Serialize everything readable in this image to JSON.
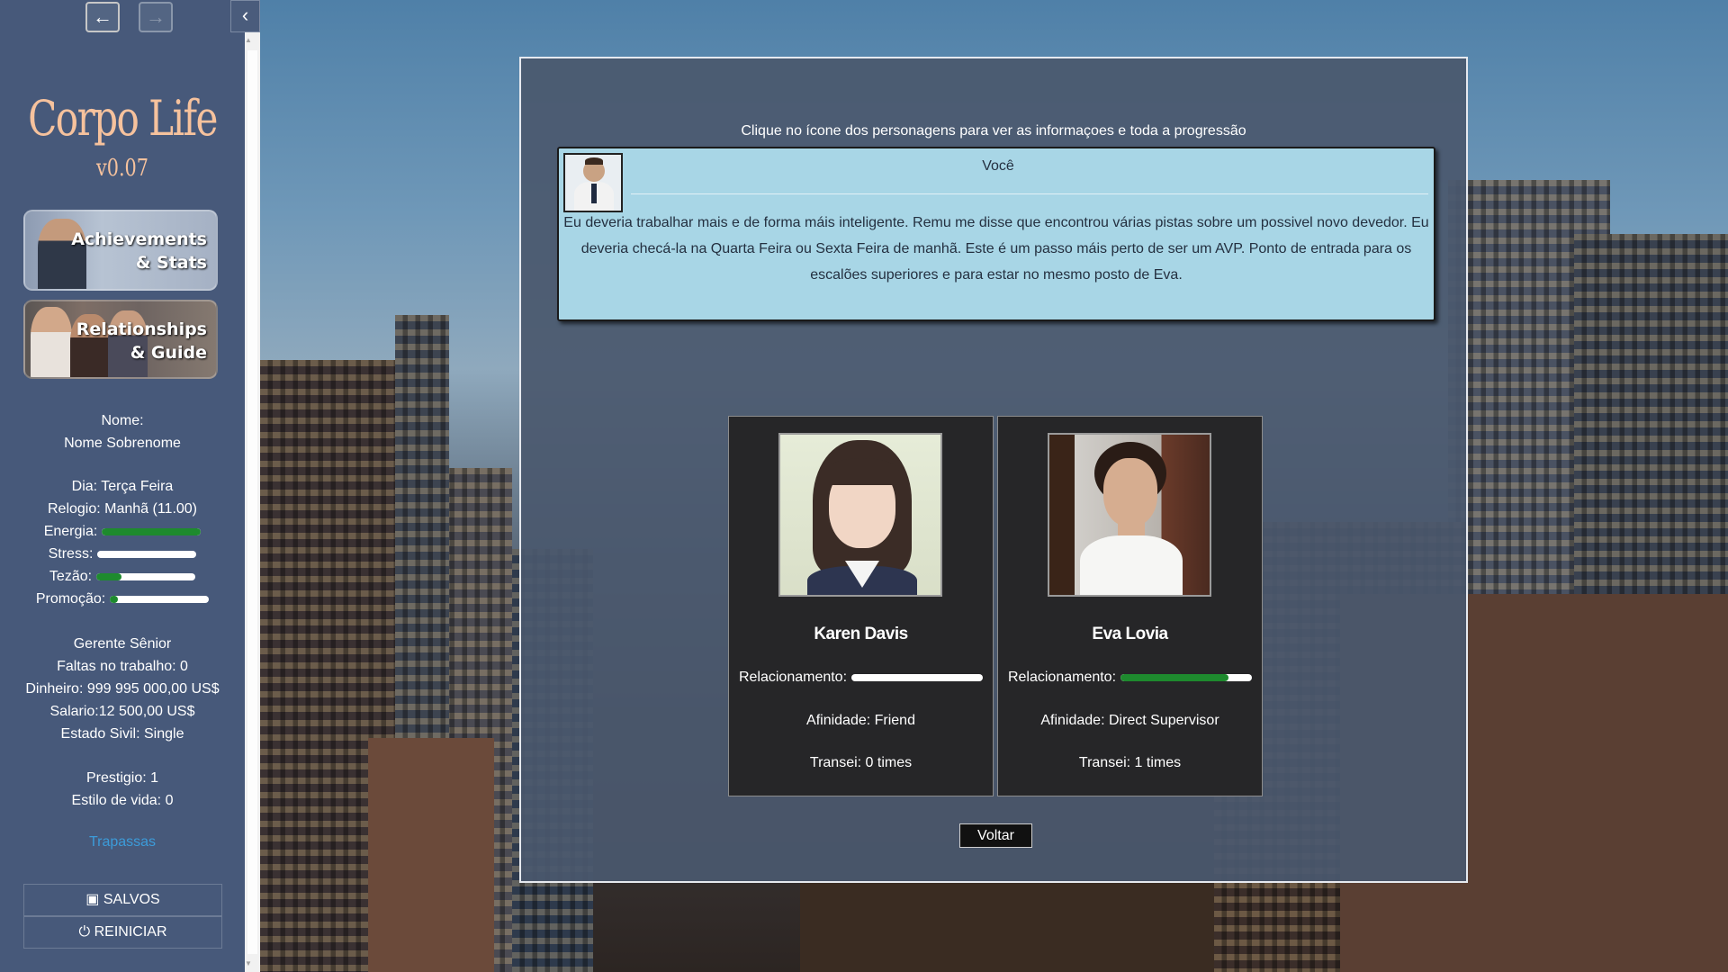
{
  "nav": {
    "back_icon": "arrow-left-icon",
    "forward_icon": "arrow-right-icon",
    "collapse_icon": "chevron-left-icon"
  },
  "sidebar": {
    "title": "Corpo Life",
    "version": "v0.07",
    "achievements_line1": "Achievements",
    "achievements_line2": "& Stats",
    "relationships_line1": "Relationships",
    "relationships_line2": "& Guide",
    "name_label": "Nome:",
    "name_value": "Nome Sobrenome",
    "day": "Dia: Terça Feira",
    "clock": "Relogio: Manhã (11.00)",
    "stats": [
      {
        "label": "Energia:",
        "value": 1.0
      },
      {
        "label": "Stress:",
        "value": 0.0
      },
      {
        "label": "Tezão:",
        "value": 0.25
      },
      {
        "label": "Promoção:",
        "value": 0.08
      }
    ],
    "position": "Gerente Sênior",
    "absences": "Faltas no trabalho: 0",
    "money": "Dinheiro: 999 995 000,00 US$",
    "salary": "Salario:12 500,00 US$",
    "marital": "Estado Sivil: Single",
    "prestige": "Prestigio: 1",
    "lifestyle": "Estilo de vida: 0",
    "cheats": "Trapassas",
    "saves": "SALVOS",
    "restart": "REINICIAR"
  },
  "dialog": {
    "hint": "Clique no ícone dos personagens para ver as informaçoes e toda a progressão",
    "you": {
      "name": "Você",
      "text": "Eu deveria trabalhar mais e de forma máis inteligente. Remu me disse que encontrou várias pistas sobre um possivel novo devedor. Eu deveria checá-la na Quarta Feira ou Sexta Feira de manhã. Este é um passo máis perto de ser um AVP. Ponto de entrada para os escalões superiores e para estar no mesmo posto de Eva."
    },
    "characters": [
      {
        "name": "Karen Davis",
        "rel_label": "Relacionamento:",
        "relationship": 0.0,
        "affinity": "Afinidade: Friend",
        "transei": "Transei: 0 times"
      },
      {
        "name": "Eva Lovia",
        "rel_label": "Relacionamento:",
        "relationship": 0.82,
        "affinity": "Afinidade: Direct Supervisor",
        "transei": "Transei: 1 times"
      }
    ],
    "back_button": "Voltar"
  },
  "colors": {
    "sidebar": "#47597a",
    "title": "#f6c29d",
    "bar_fill": "#1e8a2e",
    "card_light": "#a8d6e6",
    "card_dark": "#262628",
    "link": "#3c9bd9"
  }
}
